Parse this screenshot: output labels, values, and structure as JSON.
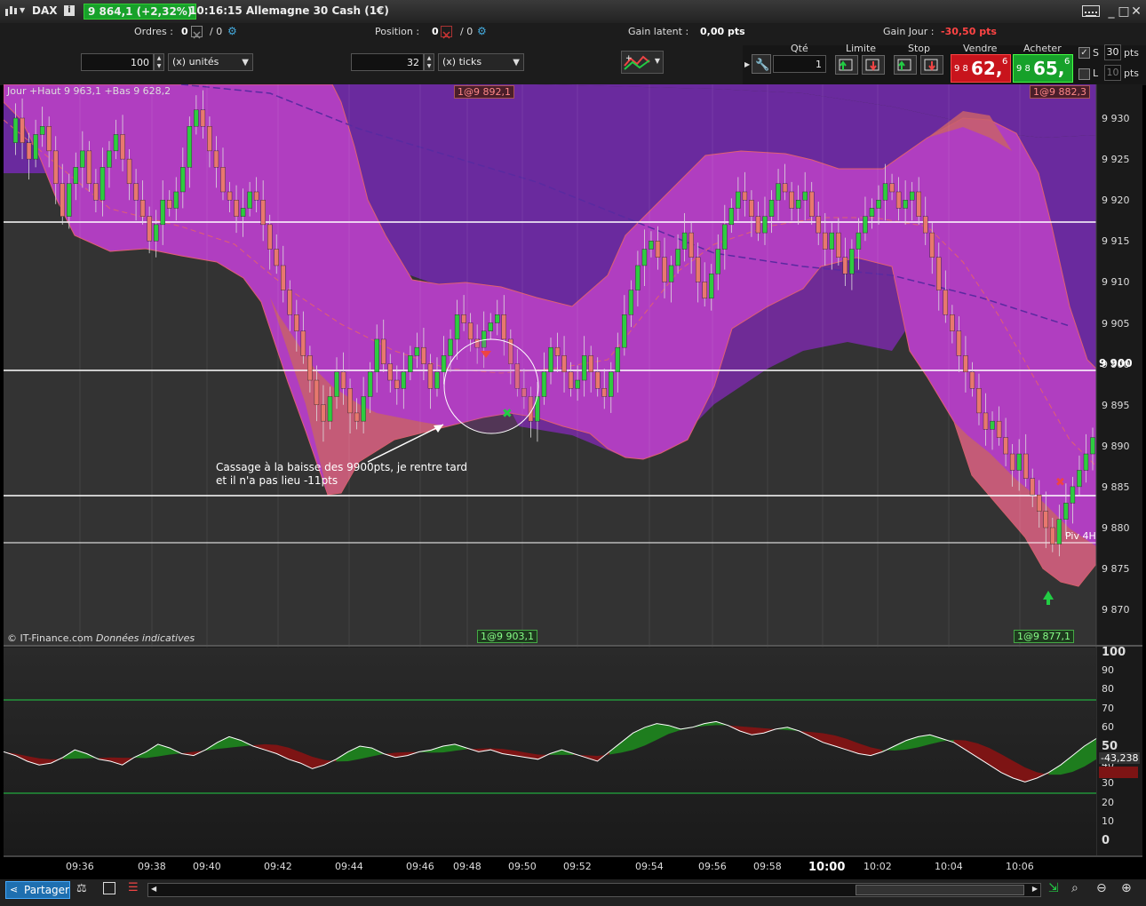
{
  "window": {
    "symbol": "DAX",
    "price_change": "9 864,1 (+2,32%)",
    "title": "10:16:15 Allemagne 30 Cash (1€)"
  },
  "toolbar": {
    "orders_label": "Ordres :",
    "orders_value": "0",
    "orders_value2": "/ 0",
    "position_label": "Position :",
    "position_value": "0",
    "position_value2": "/ 0",
    "latent_label": "Gain latent :",
    "latent_value": "0,00 pts",
    "day_label": "Gain Jour :",
    "day_value": "-30,50 pts",
    "qty_input": "100",
    "qty_unit": "(x) unités",
    "ticks_input": "32",
    "ticks_unit": "(x) ticks",
    "qte_label": "Qté",
    "qte_value": "1",
    "limite_label": "Limite",
    "stop_label": "Stop",
    "sell_label": "Vendre",
    "sell_prefix": "9 8",
    "sell_big": "62,",
    "sell_sup": "6",
    "buy_label": "Acheter",
    "buy_prefix": "9 8",
    "buy_big": "65,",
    "buy_sup": "6",
    "s_label": "S",
    "s_value": "30",
    "l_label": "L",
    "l_value": "10",
    "pts": "pts"
  },
  "chart": {
    "info": "Jour +Haut 9 963,1 +Bas 9 628,2",
    "tag_top1": "1@9 892,1",
    "tag_top2": "1@9 882,3",
    "tag_bot1": "1@9 903,1",
    "tag_bot2": "1@9 877,1",
    "annotation_line1": "Cassage à la baisse des 9900pts, je rentre tard",
    "annotation_line2": "et il n'a pas lieu -11pts",
    "pivot_label": "Piv 4H",
    "copyright": "© IT-Finance.com",
    "copyright_italic": "Données indicatives",
    "current_price_label": "9 900",
    "osc_value": "-43,238",
    "price_ticks": [
      "9 930",
      "9 925",
      "9 920",
      "9 915",
      "9 910",
      "9 905",
      "9 900",
      "9 895",
      "9 890",
      "9 885",
      "9 880",
      "9 875",
      "9 870"
    ],
    "osc_ticks": [
      "100",
      "90",
      "80",
      "70",
      "60",
      "50",
      "40",
      "30",
      "20",
      "10",
      "0"
    ],
    "time_ticks": [
      "09:36",
      "09:38",
      "09:40",
      "09:42",
      "09:44",
      "09:46",
      "09:48",
      "09:50",
      "09:52",
      "09:54",
      "09:56",
      "09:58",
      "10:00",
      "10:02",
      "10:04",
      "10:06"
    ]
  },
  "bottom": {
    "share_label": "Partager"
  },
  "colors": {
    "up": "#2ecc40",
    "down": "#e8786e",
    "band": "#b03ec0",
    "sell": "#c8141c",
    "buy": "#17a12a"
  }
}
